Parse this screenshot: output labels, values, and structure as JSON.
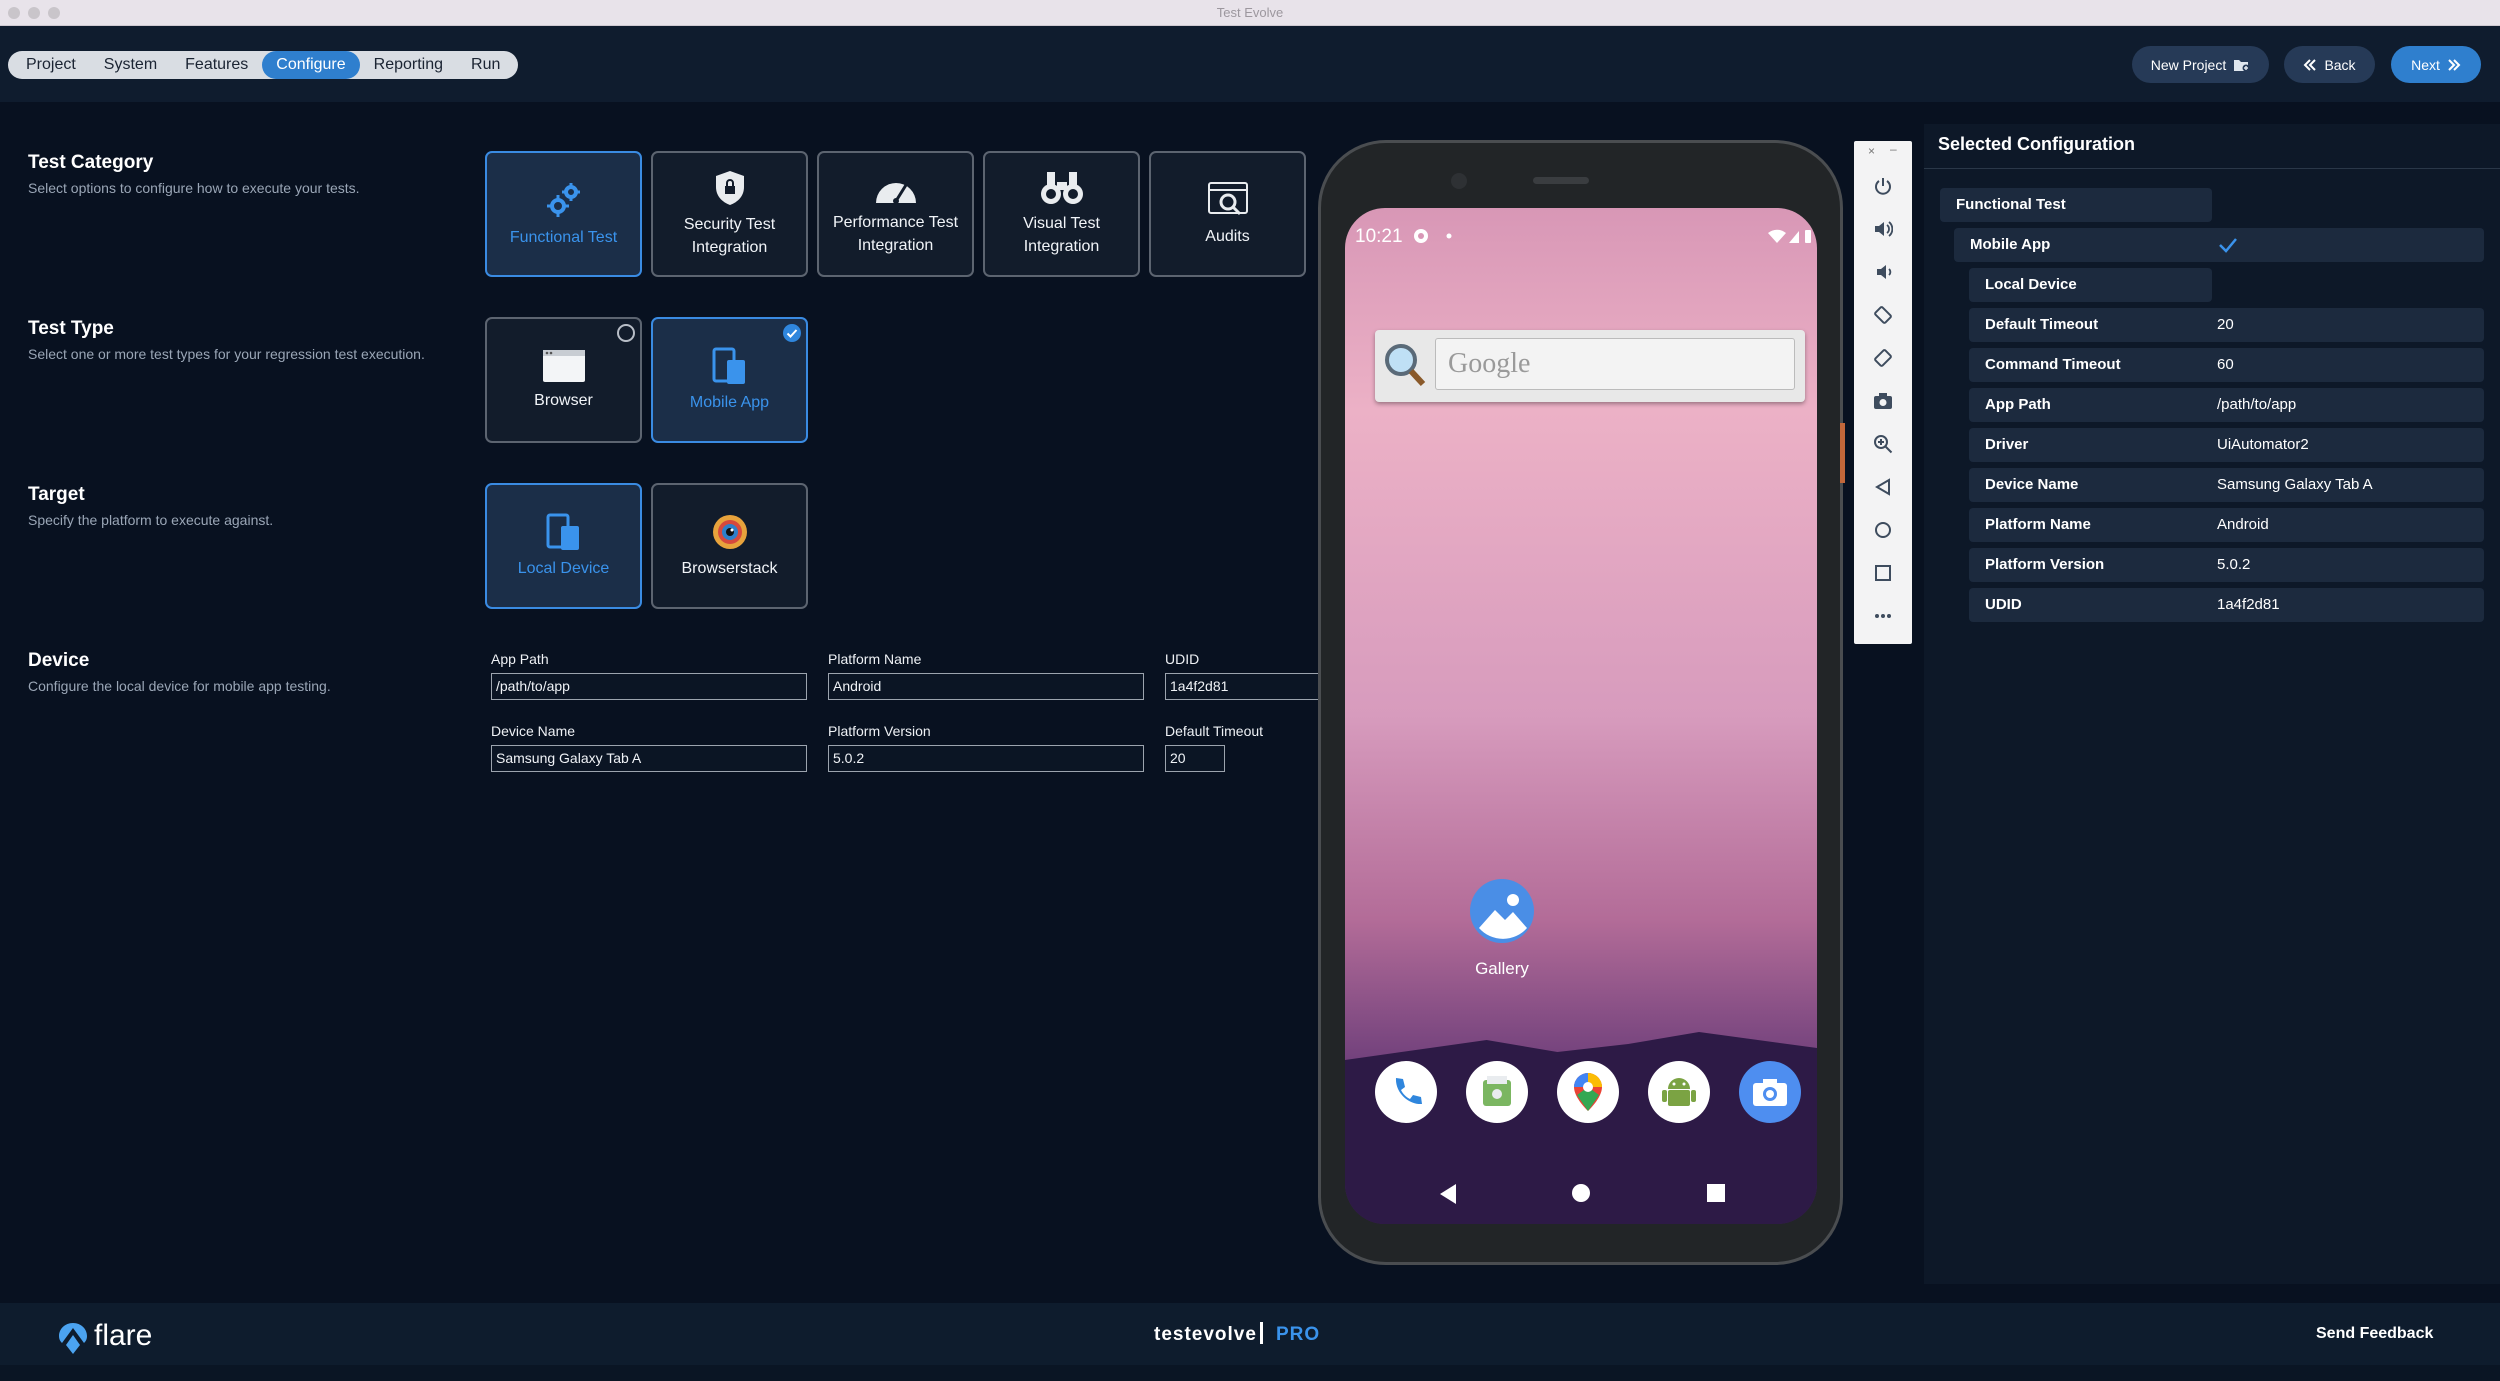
{
  "window": {
    "title": "Test Evolve"
  },
  "nav": {
    "tabs": [
      "Project",
      "System",
      "Features",
      "Configure",
      "Reporting",
      "Run"
    ],
    "active": "Configure"
  },
  "actions": {
    "new_project": "New Project",
    "back": "Back",
    "next": "Next"
  },
  "sections": {
    "test_category": {
      "title": "Test Category",
      "desc": "Select options to configure how to execute your tests."
    },
    "test_type": {
      "title": "Test Type",
      "desc": "Select one or more test types for your regression test execution."
    },
    "target": {
      "title": "Target",
      "desc": "Specify the platform to execute against."
    },
    "device": {
      "title": "Device",
      "desc": "Configure the local device for mobile app testing."
    }
  },
  "categories": [
    {
      "line1": "Functional Test",
      "line2": "",
      "icon": "gears-icon",
      "selected": true
    },
    {
      "line1": "Security Test",
      "line2": "Integration",
      "icon": "shield-icon",
      "selected": false
    },
    {
      "line1": "Performance Test",
      "line2": "Integration",
      "icon": "speedometer-icon",
      "selected": false
    },
    {
      "line1": "Visual Test",
      "line2": "Integration",
      "icon": "binoculars-icon",
      "selected": false
    },
    {
      "line1": "Audits",
      "line2": "",
      "icon": "audit-icon",
      "selected": false
    }
  ],
  "test_types": [
    {
      "label": "Browser",
      "icon": "browser-window-icon",
      "selected": false
    },
    {
      "label": "Mobile App",
      "icon": "mobile-devices-icon",
      "selected": true
    }
  ],
  "targets": [
    {
      "label": "Local Device",
      "icon": "local-device-icon",
      "selected": true
    },
    {
      "label": "Browserstack",
      "icon": "browserstack-icon",
      "selected": false
    }
  ],
  "device_fields": {
    "app_path": {
      "label": "App Path",
      "value": "/path/to/app"
    },
    "platform_name": {
      "label": "Platform Name",
      "value": "Android"
    },
    "udid": {
      "label": "UDID",
      "value": "1a4f2d81"
    },
    "device_name": {
      "label": "Device Name",
      "value": "Samsung Galaxy Tab A"
    },
    "platform_version": {
      "label": "Platform Version",
      "value": "5.0.2"
    },
    "default_timeout": {
      "label": "Default Timeout",
      "value": "20"
    }
  },
  "emulator": {
    "time": "10:21",
    "search_placeholder": "Google",
    "gallery_label": "Gallery",
    "dock_icons": [
      "phone-icon",
      "files-icon",
      "maps-icon",
      "android-icon",
      "camera-icon"
    ]
  },
  "emulator_toolbar": {
    "buttons": [
      "power-icon",
      "volume-up-icon",
      "volume-down-icon",
      "rotate-left-icon",
      "rotate-right-icon",
      "screenshot-icon",
      "zoom-icon",
      "back-icon",
      "home-icon",
      "overview-icon",
      "more-icon"
    ]
  },
  "selected_config": {
    "title": "Selected Configuration",
    "functional": "Functional Test",
    "mobile": "Mobile App",
    "local": "Local Device",
    "rows": [
      {
        "key": "Default Timeout",
        "value": "20"
      },
      {
        "key": "Command Timeout",
        "value": "60"
      },
      {
        "key": "App Path",
        "value": "/path/to/app"
      },
      {
        "key": "Driver",
        "value": "UiAutomator2"
      },
      {
        "key": "Device Name",
        "value": "Samsung Galaxy Tab A"
      },
      {
        "key": "Platform Name",
        "value": "Android"
      },
      {
        "key": "Platform Version",
        "value": "5.0.2"
      },
      {
        "key": "UDID",
        "value": "1a4f2d81"
      }
    ]
  },
  "footer": {
    "brand": "flare",
    "center_brand": "testevolve",
    "center_tier": "PRO",
    "feedback": "Send Feedback"
  },
  "colors": {
    "accent": "#2f7fce",
    "background": "#081120",
    "panel": "#0d1828"
  }
}
